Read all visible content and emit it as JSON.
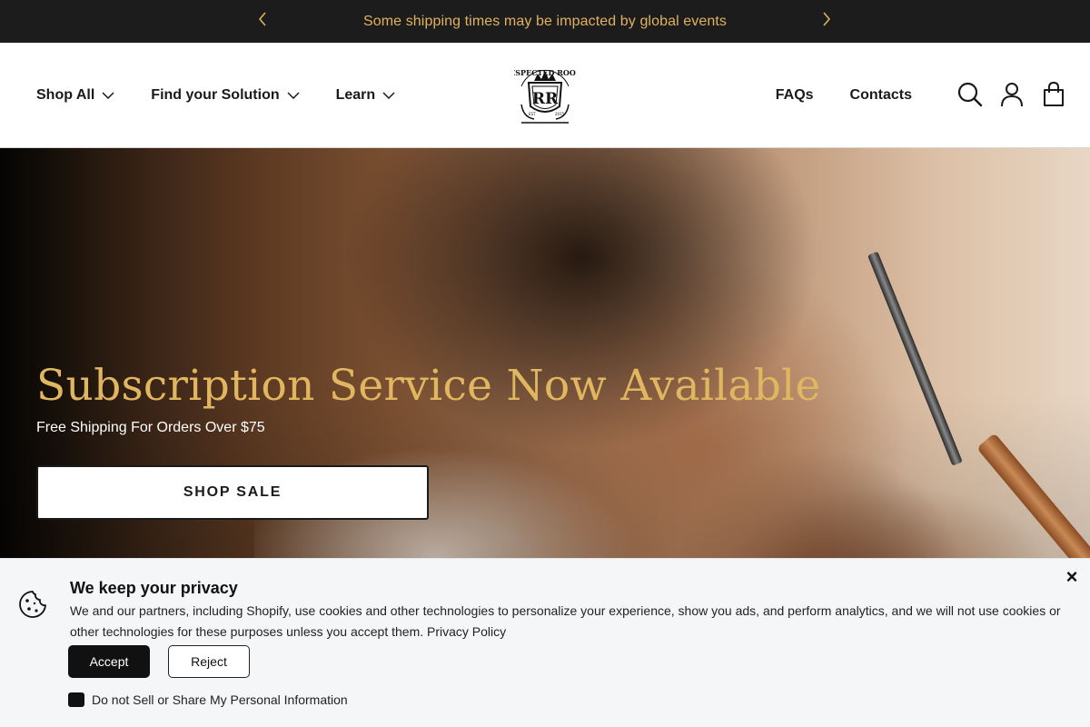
{
  "announcement": {
    "text": "Some shipping times may be impacted by global events"
  },
  "nav": {
    "left": [
      {
        "label": "Shop All"
      },
      {
        "label": "Find your Solution"
      },
      {
        "label": "Learn"
      }
    ],
    "right": [
      {
        "label": "FAQs"
      },
      {
        "label": "Contacts"
      }
    ],
    "logo_alt": "Respected Roots",
    "icons": [
      "search-icon",
      "account-icon",
      "cart-icon"
    ]
  },
  "hero": {
    "title": "Subscription Service Now Available",
    "subtitle": "Free Shipping For Orders Over $75",
    "button_label": "SHOP SALE"
  },
  "cookie_banner": {
    "title": "We keep your privacy",
    "body": "We and our partners, including Shopify, use cookies and other technologies to personalize your experience, show you ads, and perform analytics, and we will not use cookies or other technologies for these purposes unless you accept them.",
    "policy_link": "Privacy Policy",
    "accept_label": "Accept",
    "reject_label": "Reject",
    "dns_label": "Do not Sell or Share My Personal Information",
    "close_label": "×"
  },
  "colors": {
    "announcement_bg": "#1c1c1c",
    "accent_gold": "#e1b661",
    "text_dark": "#1a1a1a"
  }
}
